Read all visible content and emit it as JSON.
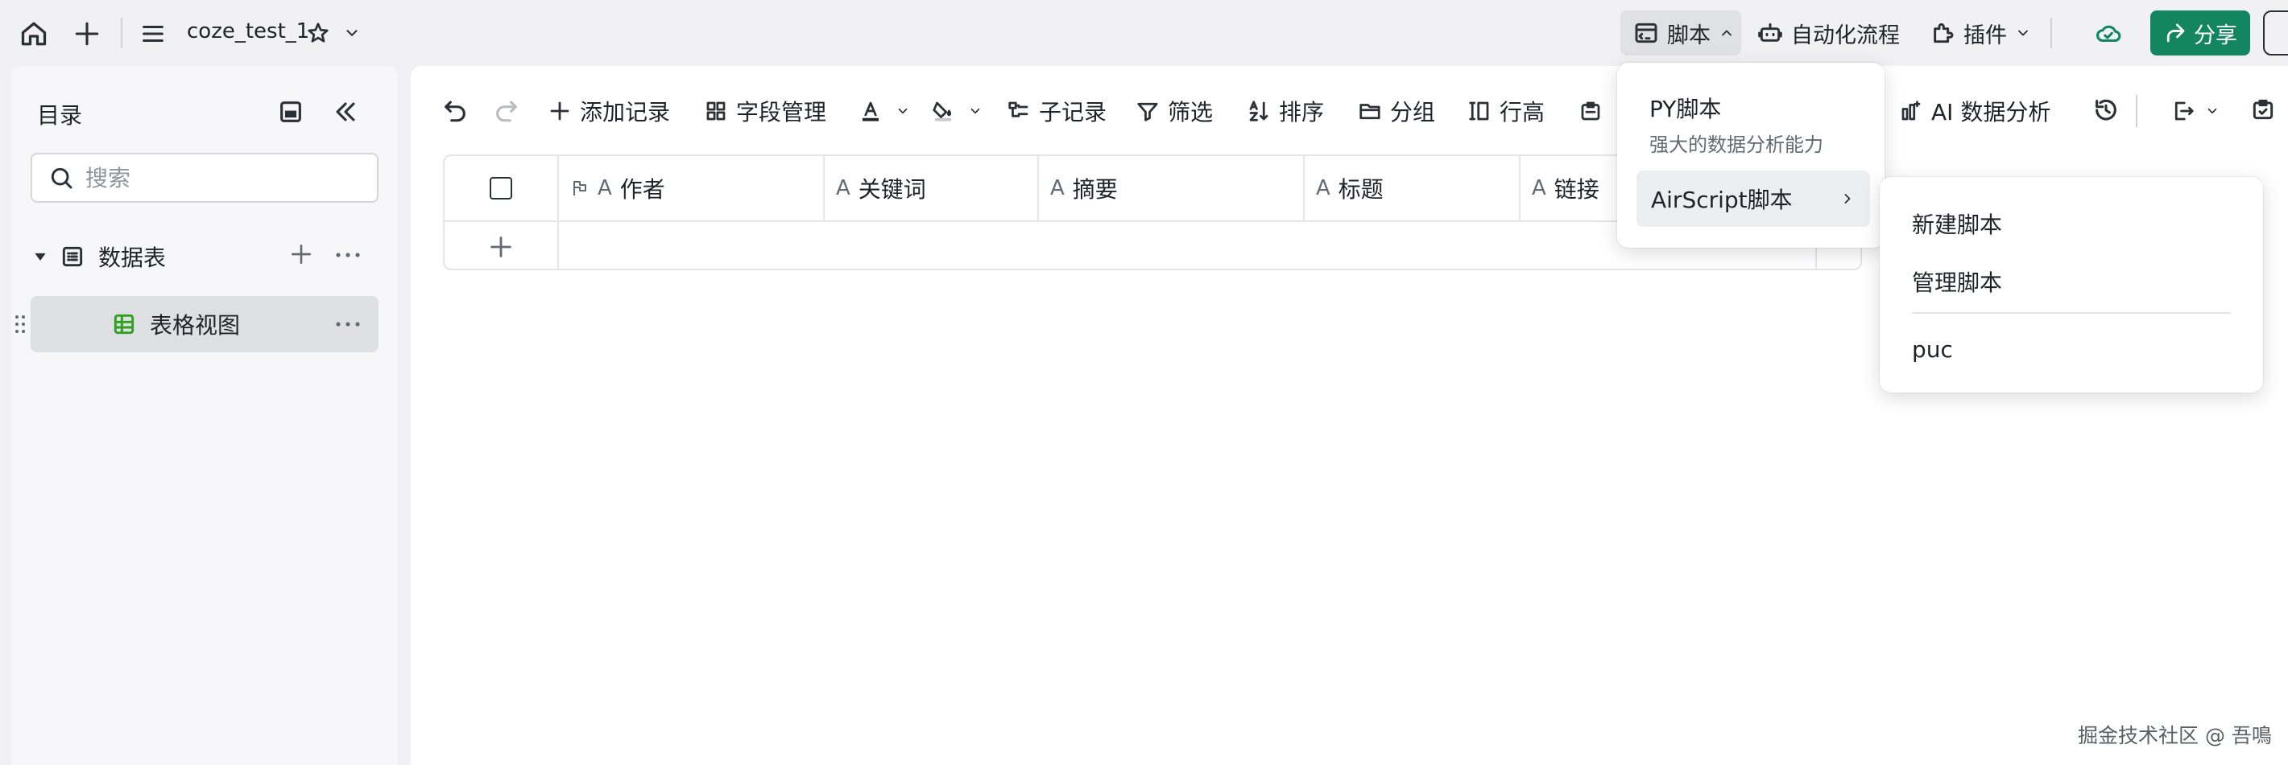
{
  "topbar": {
    "doc_title": "coze_test_1",
    "script_label": "脚本",
    "automation_label": "自动化流程",
    "plugin_label": "插件",
    "share_label": "分享"
  },
  "sidebar": {
    "title": "目录",
    "search_placeholder": "搜索",
    "tree": {
      "group_label": "数据表",
      "view_label": "表格视图"
    }
  },
  "toolbar": {
    "add_record": "添加记录",
    "field_manage": "字段管理",
    "sub_record": "子记录",
    "filter": "筛选",
    "sort": "排序",
    "group": "分组",
    "row_height": "行高",
    "ai_analysis": "AI 数据分析"
  },
  "grid": {
    "columns": [
      "作者",
      "关键词",
      "摘要",
      "标题",
      "链接"
    ]
  },
  "script_menu": {
    "py_title": "PY脚本",
    "py_desc": "强大的数据分析能力",
    "airscript": "AirScript脚本"
  },
  "sub_menu": {
    "new_script": "新建脚本",
    "manage_script": "管理脚本",
    "puc": "puc"
  },
  "watermark": "掘金技术社区 @ 吾鳴",
  "colors": {
    "accent_green": "#14865f",
    "selected_bg": "#dfe0e3"
  }
}
